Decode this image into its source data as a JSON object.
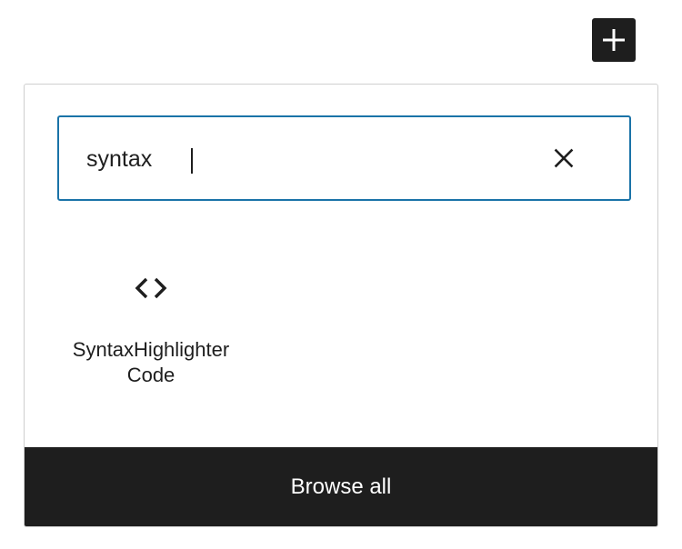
{
  "toolbar": {
    "add_icon": "plus-icon"
  },
  "inserter": {
    "search": {
      "value": "syntax",
      "clear_icon": "close-icon"
    },
    "results": [
      {
        "icon": "code-brackets-icon",
        "label": "SyntaxHighlighter Code"
      }
    ],
    "browse_all_label": "Browse all"
  },
  "colors": {
    "dark": "#1e1e1e",
    "focus_border": "#1a73a8",
    "panel_border": "#cfcfcf",
    "background": "#ffffff"
  }
}
